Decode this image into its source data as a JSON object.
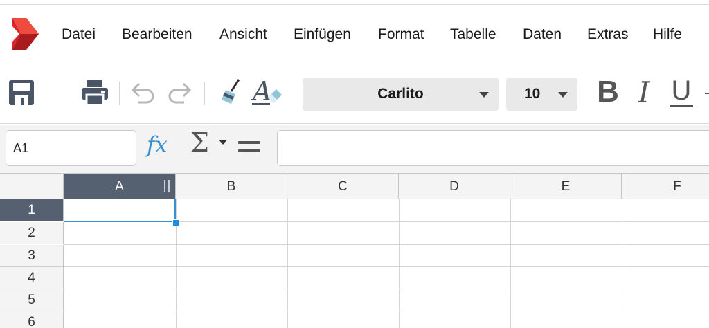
{
  "menu": {
    "items": [
      "Datei",
      "Bearbeiten",
      "Ansicht",
      "Einfügen",
      "Format",
      "Tabelle",
      "Daten",
      "Extras",
      "Hilfe"
    ]
  },
  "toolbar": {
    "icons": [
      "save-icon",
      "print-icon",
      "undo-icon",
      "redo-icon",
      "clear-formatting-icon",
      "text-style-icon"
    ],
    "font_name": "Carlito",
    "font_size": "10",
    "bold_glyph": "B",
    "italic_glyph": "I",
    "underline_glyph": "U"
  },
  "formula_bar": {
    "cell_ref": "A1",
    "fx_label": "fx",
    "sigma_label": "Σ",
    "formula_value": ""
  },
  "grid": {
    "columns": [
      "A",
      "B",
      "C",
      "D",
      "E",
      "F"
    ],
    "rows": [
      "1",
      "2",
      "3",
      "4",
      "5",
      "6"
    ],
    "selected_column": "A",
    "selected_row": "1",
    "active_cell": "A1"
  },
  "colors": {
    "accent": "#3a8fd0",
    "header_selected": "#556070",
    "logo_red": "#d9262b"
  }
}
